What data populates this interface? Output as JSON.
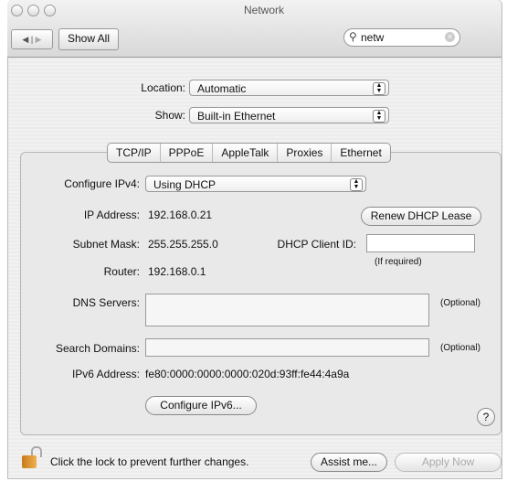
{
  "window": {
    "title": "Network"
  },
  "toolbar": {
    "show_all": "Show All",
    "search_value": "netw"
  },
  "location": {
    "label": "Location:",
    "value": "Automatic"
  },
  "show": {
    "label": "Show:",
    "value": "Built-in Ethernet"
  },
  "tabs": [
    {
      "label": "TCP/IP",
      "selected": true
    },
    {
      "label": "PPPoE"
    },
    {
      "label": "AppleTalk"
    },
    {
      "label": "Proxies"
    },
    {
      "label": "Ethernet"
    }
  ],
  "tcpip": {
    "configure_label": "Configure IPv4:",
    "configure_value": "Using DHCP",
    "ip_label": "IP Address:",
    "ip_value": "192.168.0.21",
    "renew_button": "Renew DHCP Lease",
    "subnet_label": "Subnet Mask:",
    "subnet_value": "255.255.255.0",
    "client_id_label": "DHCP Client ID:",
    "client_id_value": "",
    "client_id_hint": "(If required)",
    "router_label": "Router:",
    "router_value": "192.168.0.1",
    "dns_label": "DNS Servers:",
    "dns_value": "",
    "optional": "(Optional)",
    "search_label": "Search Domains:",
    "search_value": "",
    "ipv6_label": "IPv6 Address:",
    "ipv6_value": "fe80:0000:0000:0000:020d:93ff:fe44:4a9a",
    "configure_ipv6_button": "Configure IPv6...",
    "help": "?"
  },
  "footer": {
    "lock_text": "Click the lock to prevent further changes.",
    "assist_button": "Assist me...",
    "apply_button": "Apply Now"
  }
}
